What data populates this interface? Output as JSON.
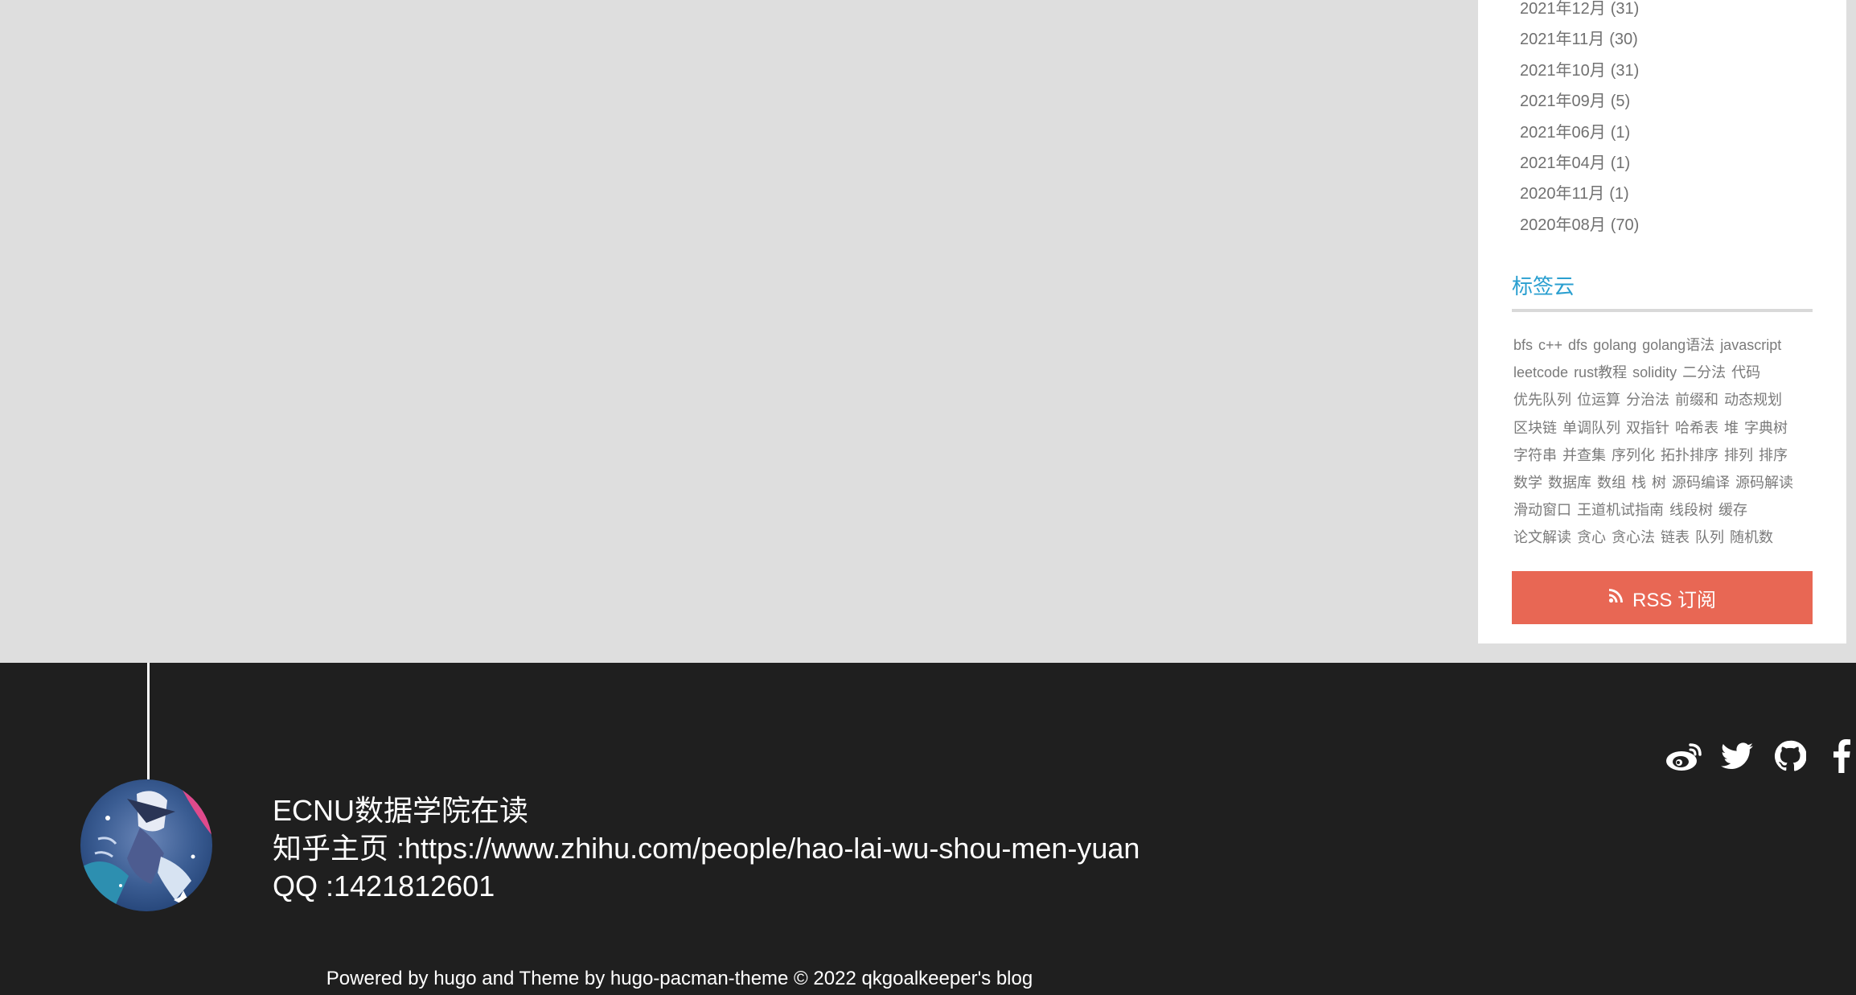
{
  "archives": [
    {
      "label": "2021年12月",
      "count": "(31)"
    },
    {
      "label": "2021年11月",
      "count": "(30)"
    },
    {
      "label": "2021年10月",
      "count": "(31)"
    },
    {
      "label": "2021年09月",
      "count": "(5)"
    },
    {
      "label": "2021年06月",
      "count": "(1)"
    },
    {
      "label": "2021年04月",
      "count": "(1)"
    },
    {
      "label": "2020年11月",
      "count": "(1)"
    },
    {
      "label": "2020年08月",
      "count": "(70)"
    }
  ],
  "tag_cloud": {
    "title": "标签云",
    "lines": [
      [
        "bfs",
        "c++",
        "dfs",
        "golang",
        "golang语法",
        "javascript"
      ],
      [
        "leetcode",
        "rust教程",
        "solidity",
        "二分法",
        "代码"
      ],
      [
        "优先队列",
        "位运算",
        "分治法",
        "前缀和",
        "动态规划"
      ],
      [
        "区块链",
        "单调队列",
        "双指针",
        "哈希表",
        "堆",
        "字典树"
      ],
      [
        "字符串",
        "并查集",
        "序列化",
        "拓扑排序",
        "排列",
        "排序"
      ],
      [
        "数学",
        "数据库",
        "数组",
        "栈",
        "树",
        "源码编译",
        "源码解读"
      ],
      [
        "滑动窗口",
        "王道机试指南",
        "线段树",
        "缓存"
      ],
      [
        "论文解读",
        "贪心",
        "贪心法",
        "链表",
        "队列",
        "随机数"
      ]
    ]
  },
  "rss": {
    "label": "RSS 订阅",
    "icon": "rss-icon",
    "color": "#e86754"
  },
  "footer": {
    "bio": {
      "line1": "ECNU数据学院在读",
      "line2": "知乎主页 :https://www.zhihu.com/people/hao-lai-wu-shou-men-yuan",
      "line3": "QQ :1421812601"
    },
    "social_icons": [
      "weibo-icon",
      "twitter-icon",
      "github-icon",
      "facebook-icon"
    ],
    "copyright": "Powered by hugo and Theme by hugo-pacman-theme © 2022 qkgoalkeeper's blog"
  },
  "colors": {
    "page_bg": "#dedede",
    "footer_bg": "#1f1f1f",
    "tag_title": "#2a9fd0"
  }
}
